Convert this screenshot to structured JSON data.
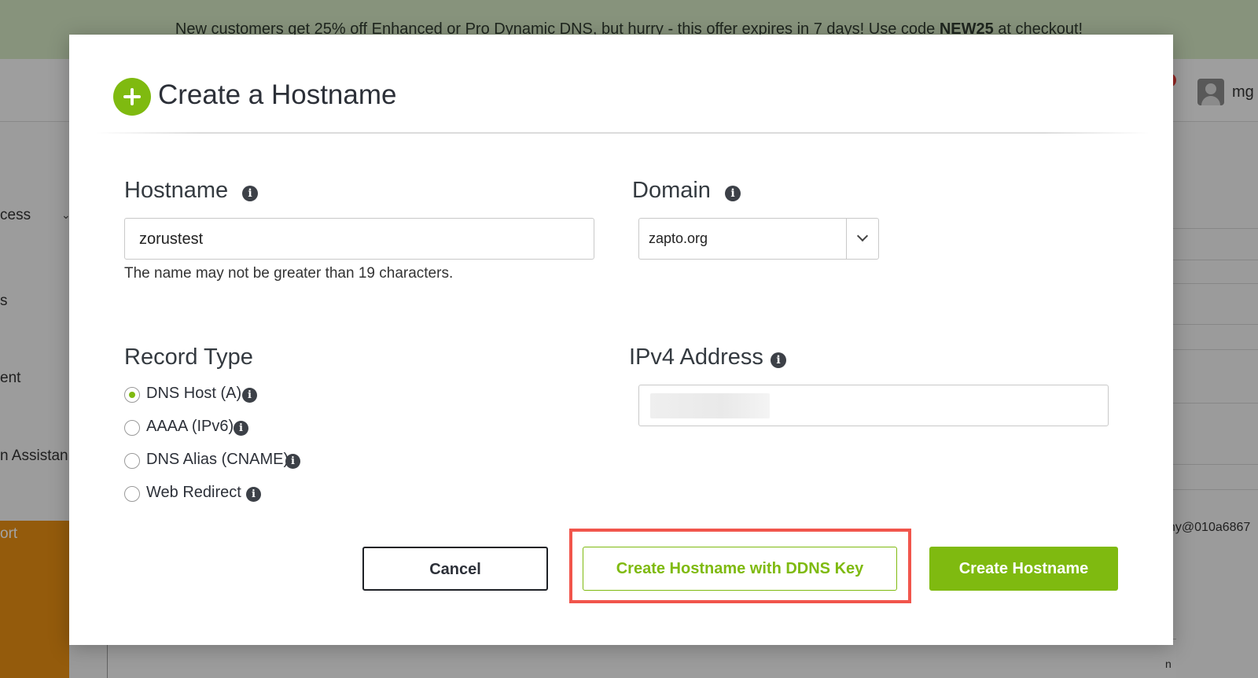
{
  "banner": {
    "text_prefix": "New customers get 25% off Enhanced or Pro Dynamic DNS, but hurry - this offer expires in 7 days! Use code ",
    "code": "NEW25",
    "text_suffix": " at checkout!"
  },
  "user": {
    "name": "mg"
  },
  "sidebar": {
    "items": [
      {
        "label": "cess"
      },
      {
        "label": "s"
      },
      {
        "label": "ent"
      },
      {
        "label": "n Assistan"
      }
    ],
    "support_label": "ort"
  },
  "background": {
    "email_fragment": "ny@010a6867",
    "bottom_fragment": "n"
  },
  "modal": {
    "title": "Create a Hostname",
    "hostname": {
      "label": "Hostname",
      "value": "zorustest",
      "helper": "The name may not be greater than 19 characters."
    },
    "domain": {
      "label": "Domain",
      "selected": "zapto.org"
    },
    "record_type": {
      "label": "Record Type",
      "options": [
        {
          "label": "DNS Host (A)",
          "checked": true
        },
        {
          "label": "AAAA (IPv6)",
          "checked": false
        },
        {
          "label": "DNS Alias (CNAME)",
          "checked": false
        },
        {
          "label": "Web Redirect",
          "checked": false
        }
      ]
    },
    "ipv4": {
      "label": "IPv4 Address",
      "value": ""
    },
    "buttons": {
      "cancel": "Cancel",
      "create_with_key": "Create Hostname with DDNS Key",
      "create": "Create Hostname"
    },
    "info_glyph": "i"
  },
  "colors": {
    "accent_green": "#7fba10",
    "highlight_red": "#f1554c",
    "banner_bg": "#d3e6c2",
    "sidebar_support": "#e88f14"
  }
}
